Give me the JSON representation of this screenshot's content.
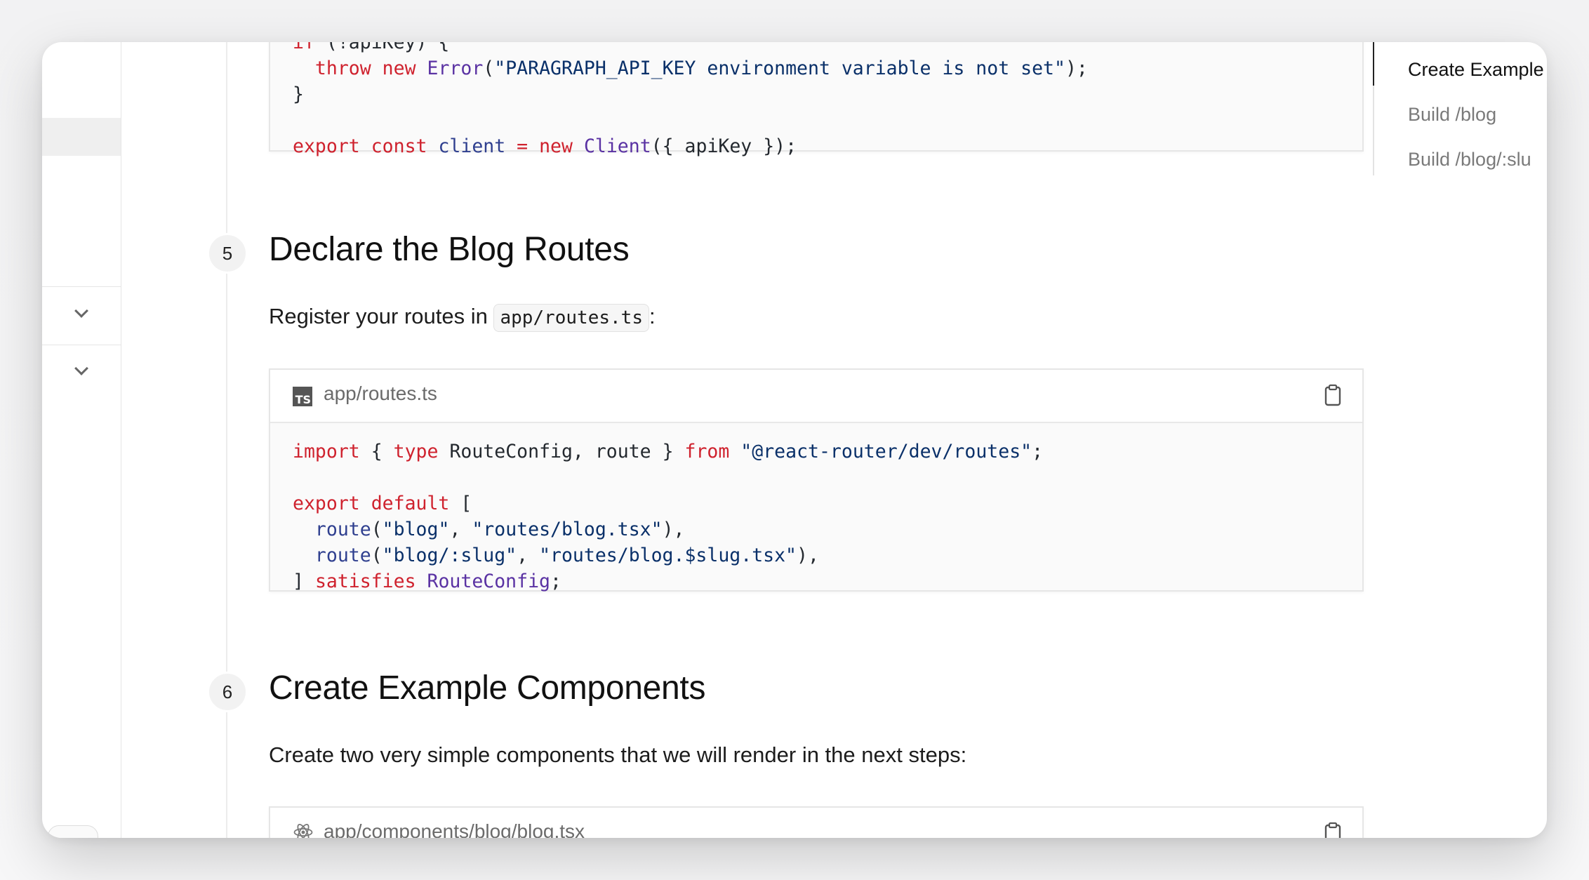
{
  "steps": [
    {
      "number": "5",
      "title": "Declare the Blog Routes",
      "intro_text": "Register your routes in ",
      "intro_code": "app/routes.ts",
      "intro_suffix": ":",
      "code_file": {
        "icon": "typescript-icon",
        "icon_label": "TS",
        "filename": "app/routes.ts"
      }
    },
    {
      "number": "6",
      "title": "Create Example Components",
      "intro_text": "Create two very simple components that we will render in the next steps:",
      "code_file": {
        "icon": "react-icon",
        "filename": "app/components/blog/blog.tsx"
      }
    }
  ],
  "toc": {
    "items": [
      {
        "label": "Create Example",
        "active": true
      },
      {
        "label": "Build /blog",
        "active": false
      },
      {
        "label": "Build /blog/:slu",
        "active": false
      }
    ]
  },
  "sidebar": {
    "icons": [
      "chevron-down-icon",
      "chevron-down-icon"
    ]
  },
  "code_blocks": {
    "top_snippet_lines": [
      "if (!apiKey) {",
      "  throw new Error(\"PARAGRAPH_API_KEY environment variable is not set\");",
      "}",
      "",
      "export const client = new Client({ apiKey });"
    ],
    "routes_lines": [
      "import { type RouteConfig, route } from \"@react-router/dev/routes\";",
      "",
      "export default [",
      "  route(\"blog\", \"routes/blog.tsx\"),",
      "  route(\"blog/:slug\", \"routes/blog.$slug.tsx\"),",
      "] satisfies RouteConfig;"
    ]
  },
  "colors": {
    "keyword": "#cf222e",
    "function": "#5a32a3",
    "string": "#0a3069"
  }
}
